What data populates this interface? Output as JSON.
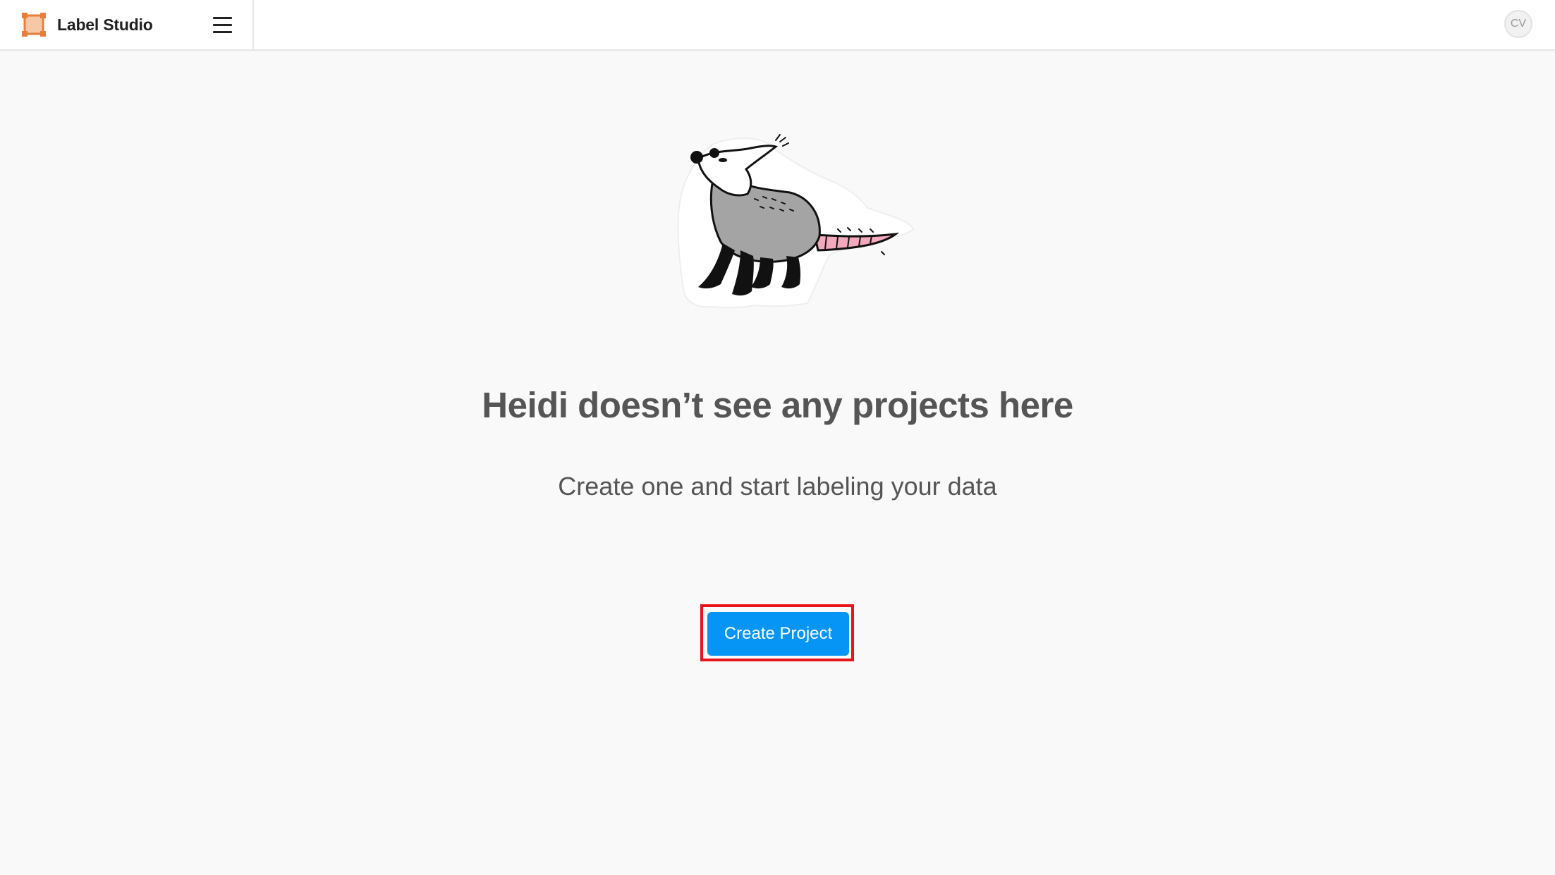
{
  "app": {
    "name": "Label Studio",
    "brand_color": "#e67e3c"
  },
  "header": {
    "menu_icon": "hamburger-menu-icon",
    "user_initials": "CV"
  },
  "empty_state": {
    "illustration": "opossum-mascot-illustration",
    "title": "Heidi doesn’t see any projects here",
    "subtitle": "Create one and start labeling your data",
    "create_button_label": "Create Project",
    "button_color": "#0795f5",
    "highlight_color": "#e8141c"
  }
}
